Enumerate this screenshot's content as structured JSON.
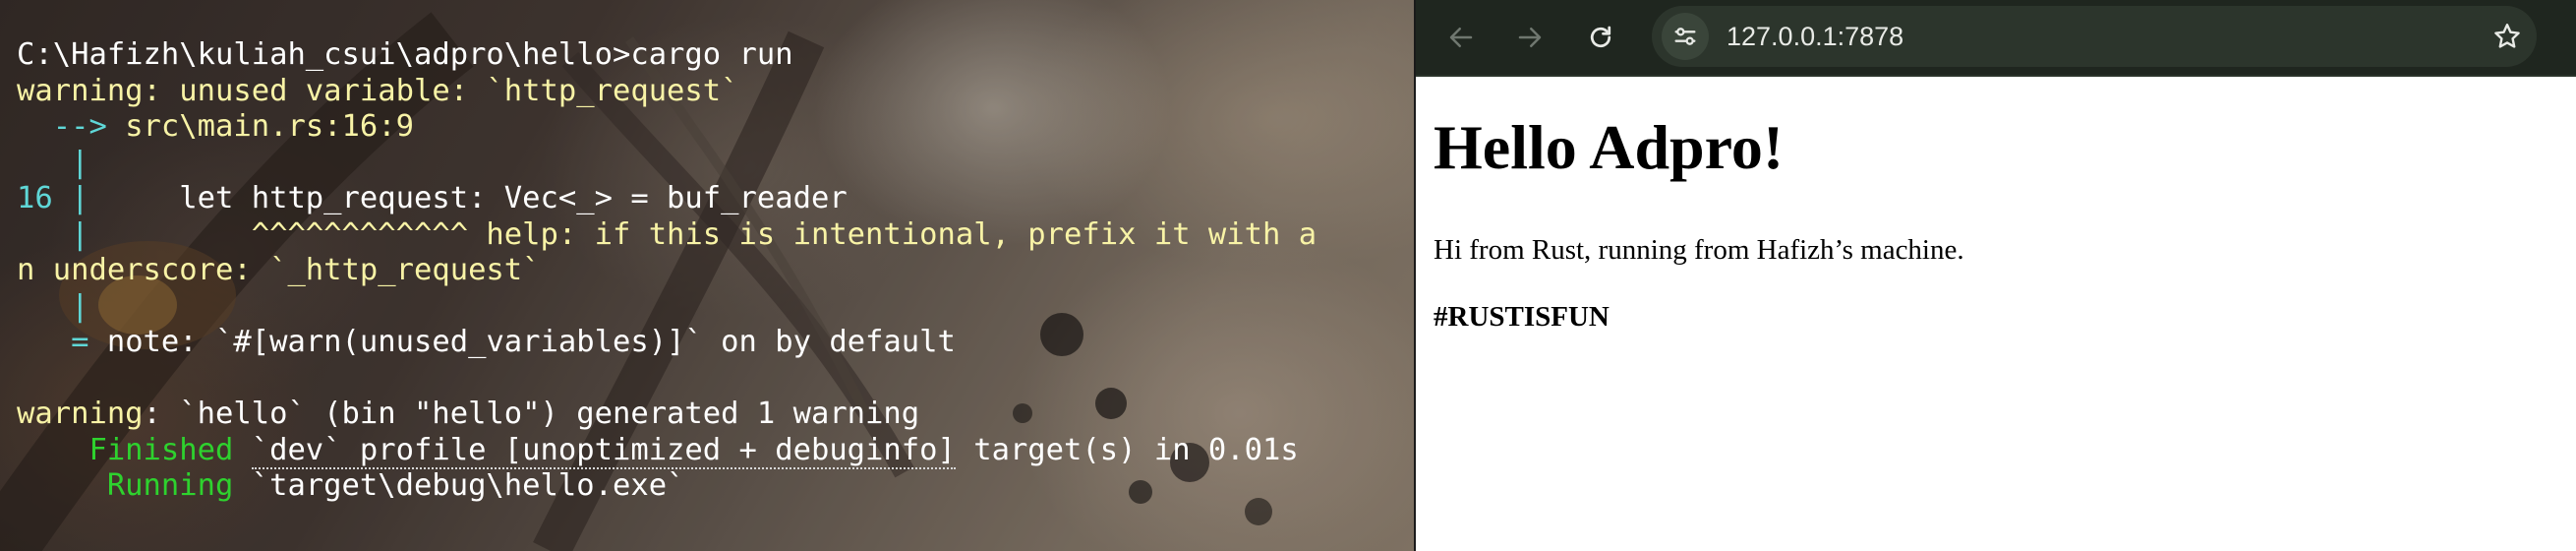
{
  "terminal": {
    "lines": [
      [
        {
          "text": "C:\\Hafizh\\kuliah_csui\\adpro\\hello>cargo run",
          "color": "white"
        }
      ],
      [
        {
          "text": "warning",
          "color": "yellow"
        },
        {
          "text": ": unused variable: `http_request`",
          "color": "yellow"
        }
      ],
      [
        {
          "text": "  --> ",
          "color": "cyan"
        },
        {
          "text": "src\\main.rs:16:9",
          "color": "yellow"
        }
      ],
      [
        {
          "text": "   |",
          "color": "cyan"
        }
      ],
      [
        {
          "text": "16 |",
          "color": "cyan"
        },
        {
          "text": "     let http_request: Vec<_> = buf_reader",
          "color": "white"
        }
      ],
      [
        {
          "text": "   |",
          "color": "cyan"
        },
        {
          "text": "         ^^^^^^^^^^^^ help: if this is intentional, prefix it with a",
          "color": "yellow"
        }
      ],
      [
        {
          "text": "n underscore: `_http_request`",
          "color": "yellow"
        }
      ],
      [
        {
          "text": "   |",
          "color": "cyan"
        }
      ],
      [
        {
          "text": "   = ",
          "color": "cyan"
        },
        {
          "text": "note",
          "color": "white"
        },
        {
          "text": ": `#[warn(unused_variables)]` on by default",
          "color": "white"
        }
      ],
      [
        {
          "text": "",
          "color": "white"
        }
      ],
      [
        {
          "text": "warning",
          "color": "yellow"
        },
        {
          "text": ": `hello` (bin \"hello\") generated 1 warning",
          "color": "white"
        }
      ],
      [
        {
          "text": "    Finished ",
          "color": "green"
        },
        {
          "text": "`dev` profile [unoptimized + debuginfo]",
          "color": "white",
          "dotted": true
        },
        {
          "text": " target(s) in 0.01s",
          "color": "white"
        }
      ],
      [
        {
          "text": "     Running ",
          "color": "green"
        },
        {
          "text": "`target\\debug\\hello.exe`",
          "color": "white"
        }
      ]
    ]
  },
  "browser": {
    "back_icon": "arrow-left-icon",
    "forward_icon": "arrow-right-icon",
    "reload_icon": "reload-icon",
    "site_info_icon": "tune-icon",
    "bookmark_icon": "star-icon",
    "url": "127.0.0.1:7878",
    "toolbar_color": "#1f261f"
  },
  "page": {
    "heading": "Hello Adpro!",
    "paragraph": "Hi from Rust, running from Hafizh’s machine.",
    "hashtag": "#RUSTISFUN"
  }
}
